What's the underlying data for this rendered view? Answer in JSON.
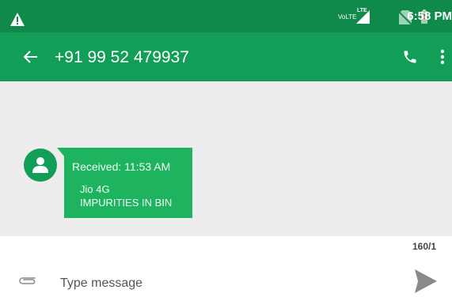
{
  "status_bar": {
    "volte_label": "VoLTE",
    "lte_label": "LTE",
    "time": "6:58 PM",
    "icons": [
      "warning-icon",
      "signal-icon",
      "no-sim-icon",
      "battery-icon"
    ]
  },
  "app_bar": {
    "title": "+91 99 52 479937",
    "icons": [
      "back-arrow-icon",
      "phone-icon",
      "more-vert-icon"
    ]
  },
  "messages": [
    {
      "received_label": "Received: 11:53 AM",
      "body_lines": [
        "Jio 4G",
        "IMPURITIES IN BIN"
      ],
      "avatar_icon": "person-icon"
    }
  ],
  "composer": {
    "counter": "160/1",
    "placeholder": "Type message",
    "icons": [
      "attach-icon",
      "send-icon"
    ]
  },
  "colors": {
    "status_bar": "#0f8a4b",
    "app_bar": "#129e56",
    "bubble": "#1eb35f",
    "chat_background": "#ededed"
  }
}
